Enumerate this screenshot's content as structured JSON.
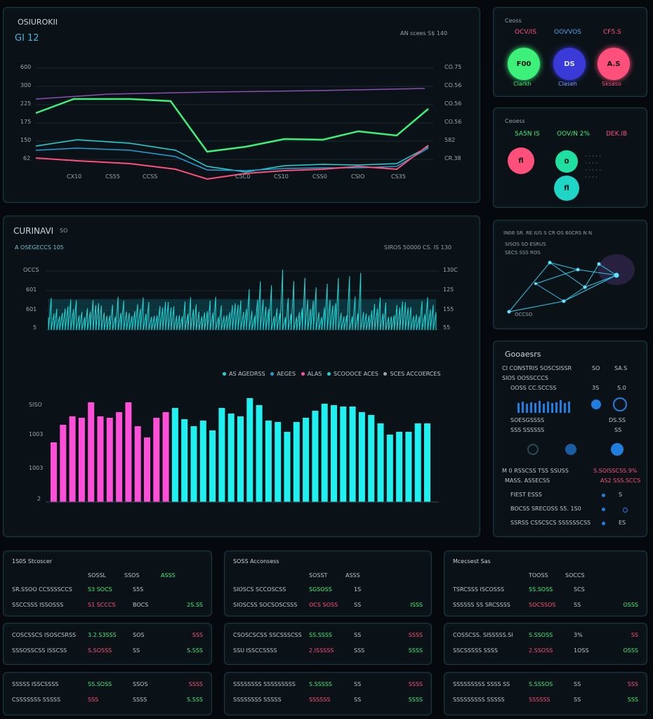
{
  "colors": {
    "green": "#3cf07a",
    "cyan": "#1fd6d6",
    "pink": "#ff4f7b",
    "blue": "#3a3ad8",
    "magenta": "#d84fd0",
    "purple": "#8a4fb0",
    "bg": "#0b1217"
  },
  "top_chart": {
    "title": "OSIUROKII",
    "subtitle": "GI 12",
    "legend": "AN  scees S$ 140",
    "y_left": [
      "600",
      "300",
      "225",
      "175",
      "150",
      "62"
    ],
    "y_right": [
      "CO.75",
      "CO.56",
      "CO.56",
      "CO.56",
      "582",
      "CR.38"
    ],
    "x_labels": [
      "CX10",
      "CS55",
      "CCSS",
      "C5C0",
      "CS10",
      "CSS0",
      "CSIO",
      "CS35"
    ]
  },
  "top_right_1": {
    "title": "Ceoss",
    "labels": [
      "OCV/IS",
      "OOVVOS",
      "CF5.S"
    ],
    "circles": [
      "F00",
      "DS",
      "A.S"
    ],
    "captions": [
      "Clarkh",
      "Claseh",
      "Sksaso"
    ]
  },
  "top_right_2": {
    "title": "Ceoess",
    "labels": [
      "SA5N IS",
      "OOV/N 2%",
      "DEK.IB"
    ],
    "circles": [
      "fl",
      "0",
      "fl"
    ]
  },
  "mid_chart": {
    "title": "CURINAVI",
    "title_suffix": "SO",
    "subtitle": "A  OSEGECCS 105",
    "right_info": "SIROS 50000    CS.  IS  130",
    "y_left": [
      "OCCS",
      "601",
      "601",
      "5"
    ],
    "y_right": [
      "130C",
      "125",
      "155",
      "55"
    ]
  },
  "bar_chart": {
    "legend": [
      "AS AGEDRSS",
      "AEGES",
      "ALAS",
      "SCOOOCE ACES",
      "SCES ACCOERCES"
    ],
    "y_labels": [
      "SISO",
      "1003",
      "1003",
      "2"
    ]
  },
  "network_panel": {
    "title": "IN06 SR. RE IUS S   CR OS 60CRS N N",
    "line2": "SISOS  SO  ESRUS",
    "line3": "SECS  SSS  ROS",
    "caption": "OCCSO"
  },
  "right_list": {
    "title": "Gooaesrs",
    "rows": [
      {
        "a": "CI CONSTRIS SOSCSISSR",
        "b": "SO",
        "c": "SA.S"
      },
      {
        "a": "SIOS  OOSSCCCS",
        "b": "",
        "c": ""
      },
      {
        "a": "OOSS CC.SCCSS",
        "b": "3S",
        "c": "S.0"
      }
    ],
    "mid_a": "SOESGSSSS",
    "mid_b": "SSS SSSSSS",
    "mid_c": "SS",
    "mid_d": "DS.SS",
    "section": "M 0 RSSCSS   TSS SSUSS",
    "section_b": "S.SOISSCSS.9%",
    "section2": "MASS. ASSECSS",
    "section2_b": "AS2 SSS.SCCS",
    "items": [
      {
        "a": "FIEST  ESSS",
        "b": "S"
      },
      {
        "a": "BOCSS SRECOSS S5. 1S0",
        "b": ""
      },
      {
        "a": "SSRSS CSSCSCS SSSSSSCSS",
        "b": "ES"
      }
    ]
  },
  "cards": [
    {
      "title": "1S0S  Stcoscer",
      "head": [
        "SOSSL",
        "SSOS",
        "ASSS"
      ],
      "rows": [
        [
          "SR.SSOO CCSSSSCCS",
          "S3 SOCS",
          "S5S",
          ""
        ],
        [
          "SSCCSSS ISSOSSS",
          "S1 SCCCS",
          "BOCS",
          "2S.SS"
        ]
      ]
    },
    {
      "title": "SOSS  Acconsess",
      "head": [
        "SOSST",
        "ASSS",
        ""
      ],
      "rows": [
        [
          "SIOSCS  SCCOSCSS",
          "SGSOSS",
          "1S",
          ""
        ],
        [
          "SIOSCSS  SOCSOSCSSS",
          "OCS SOSS",
          "SS",
          "ISSS"
        ]
      ]
    },
    {
      "title": "Mcecsest  Sas",
      "head": [
        "TOOSS",
        "SOCCS",
        ""
      ],
      "rows": [
        [
          "TSRCSSS  ISCOSSS",
          "SS.SOSS",
          "SCS",
          ""
        ],
        [
          "SSSSSS SS  SRCSSSS",
          "SOCSSOS",
          "SS",
          "OSSS"
        ]
      ]
    },
    {
      "title": "",
      "head": [],
      "rows": [
        [
          "COSCSSCS ISOSCSRSS",
          "3.2.S3SSS",
          "SOS",
          "SSS"
        ],
        [
          "SSSOSSCSS  ISSCSS",
          "S.SOSSS",
          "SS",
          "S.SSS"
        ]
      ]
    },
    {
      "title": "",
      "head": [],
      "rows": [
        [
          "CSOSCSCSS SSCSSSCSS",
          "SS.SSSS",
          "SS",
          "SSSS"
        ],
        [
          "SSU ISSCCSSSS",
          "2.ISSSSS",
          "SSS",
          "SSSS"
        ]
      ]
    },
    {
      "title": "",
      "head": [],
      "rows": [
        [
          "COSSCSS.  SISSSSS.SI",
          "S.SSOSS",
          "3%",
          "SS"
        ],
        [
          "SSCSSSSS  SSSS",
          "2.SSOSS",
          "1OSS",
          "OSSS"
        ]
      ]
    },
    {
      "title": "",
      "head": [],
      "rows": [
        [
          "SSSSS  ISSCSSSS",
          "SS.SOSS",
          "SSOS",
          "SSSS"
        ],
        [
          "CSSSSSSS SSSSS",
          "SSS",
          "SSSS",
          "S.SSS"
        ]
      ]
    },
    {
      "title": "",
      "head": [],
      "rows": [
        [
          "SSSSSSSS SSSSSSSSS",
          "S.SSSSS",
          "SS",
          "SSSS"
        ],
        [
          "SSSSSSSS  SSSSS",
          "SSSSSS",
          "SS",
          "SSSS"
        ]
      ]
    },
    {
      "title": "",
      "head": [],
      "rows": [
        [
          "SSSSSSSSS SSSS SS",
          "S.SSSOS",
          "SS",
          "SSS"
        ],
        [
          "SSSSSSSSS SSSSS",
          "SSSSSS",
          "SS",
          "SSS"
        ]
      ]
    }
  ]
}
